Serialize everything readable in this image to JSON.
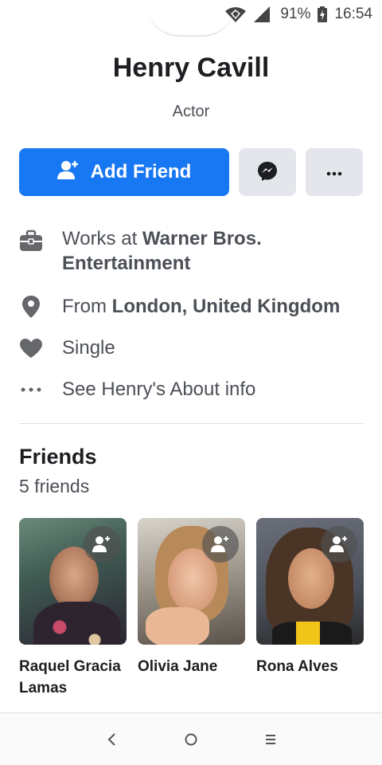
{
  "status_bar": {
    "battery_percent": "91%",
    "time": "16:54",
    "icons": [
      "wifi-icon",
      "signal-icon",
      "battery-charging-icon"
    ]
  },
  "profile": {
    "name": "Henry Cavill",
    "bio": "Actor"
  },
  "actions": {
    "add_friend_label": "Add Friend",
    "messenger_icon": "messenger-icon",
    "more_icon": "more-icon"
  },
  "info": {
    "work_prefix": "Works at ",
    "work_place_line1": "Warner Bros.",
    "work_place_line2": "Entertainment",
    "from_prefix": "From ",
    "from_place": "London, United Kingdom",
    "relationship": "Single",
    "about_link": "See Henry's About info"
  },
  "friends": {
    "title": "Friends",
    "count": "5 friends",
    "list": [
      {
        "name": "Raquel Gracia Lamas"
      },
      {
        "name": "Olivia Jane"
      },
      {
        "name": "Rona Alves"
      }
    ]
  },
  "colors": {
    "primary": "#1877f2",
    "secondary_button": "#e4e6eb",
    "icon_gray": "#65676b"
  }
}
